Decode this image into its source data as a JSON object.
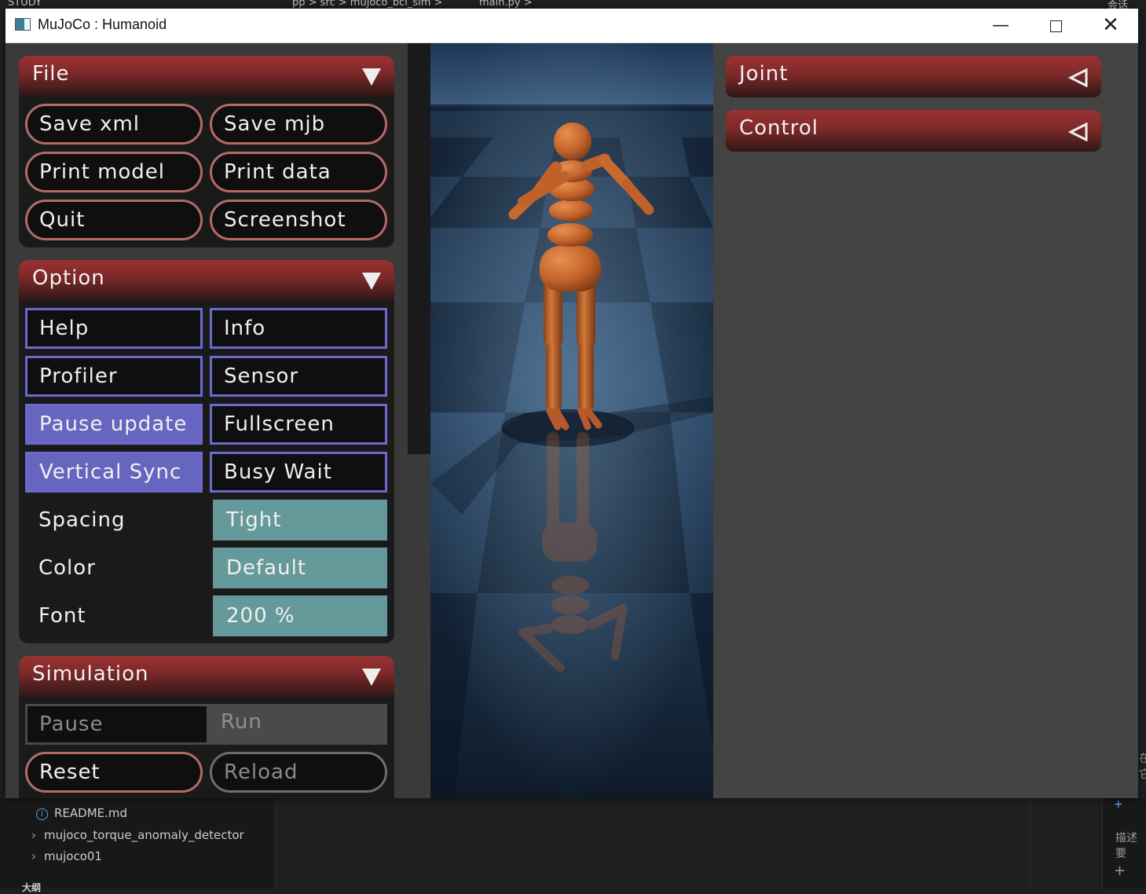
{
  "background": {
    "top_fragments": [
      "STUDY",
      "pp > src > mujoco_bci_sim > ",
      "main.py >",
      "会话"
    ],
    "tree_items": [
      {
        "label": "README.md",
        "kind": "file"
      },
      {
        "label": "mujoco_torque_anomaly_detector",
        "kind": "folder"
      },
      {
        "label": "mujoco01",
        "kind": "folder"
      }
    ],
    "right_edge_text": [
      "在",
      "它",
      "描述要"
    ],
    "bottom_left_text": "大纲"
  },
  "window": {
    "title": "MuJoCo : Humanoid",
    "controls": {
      "minimize": "—",
      "close": "✕"
    }
  },
  "file_section": {
    "title": "File",
    "buttons": [
      "Save xml",
      "Save mjb",
      "Print model",
      "Print data",
      "Quit",
      "Screenshot"
    ]
  },
  "option_section": {
    "title": "Option",
    "toggles": [
      {
        "label": "Help",
        "on": false
      },
      {
        "label": "Info",
        "on": false
      },
      {
        "label": "Profiler",
        "on": false
      },
      {
        "label": "Sensor",
        "on": false
      },
      {
        "label": "Pause update",
        "on": true
      },
      {
        "label": "Fullscreen",
        "on": false
      },
      {
        "label": "Vertical Sync",
        "on": true
      },
      {
        "label": "Busy Wait",
        "on": false
      }
    ],
    "selects": [
      {
        "label": "Spacing",
        "value": "Tight"
      },
      {
        "label": "Color",
        "value": "Default"
      },
      {
        "label": "Font",
        "value": "200 %"
      }
    ]
  },
  "simulation_section": {
    "title": "Simulation",
    "mode": {
      "pause": "Pause",
      "run": "Run",
      "selected": "Run"
    },
    "buttons": {
      "reset": "Reset",
      "reload": "Reload"
    }
  },
  "right_sections": [
    {
      "title": "Joint"
    },
    {
      "title": "Control"
    }
  ],
  "colors": {
    "section_header": "#9a3232",
    "toggle_on": "#6666c0",
    "select_bg": "#669999",
    "humanoid": "#c0612a"
  }
}
